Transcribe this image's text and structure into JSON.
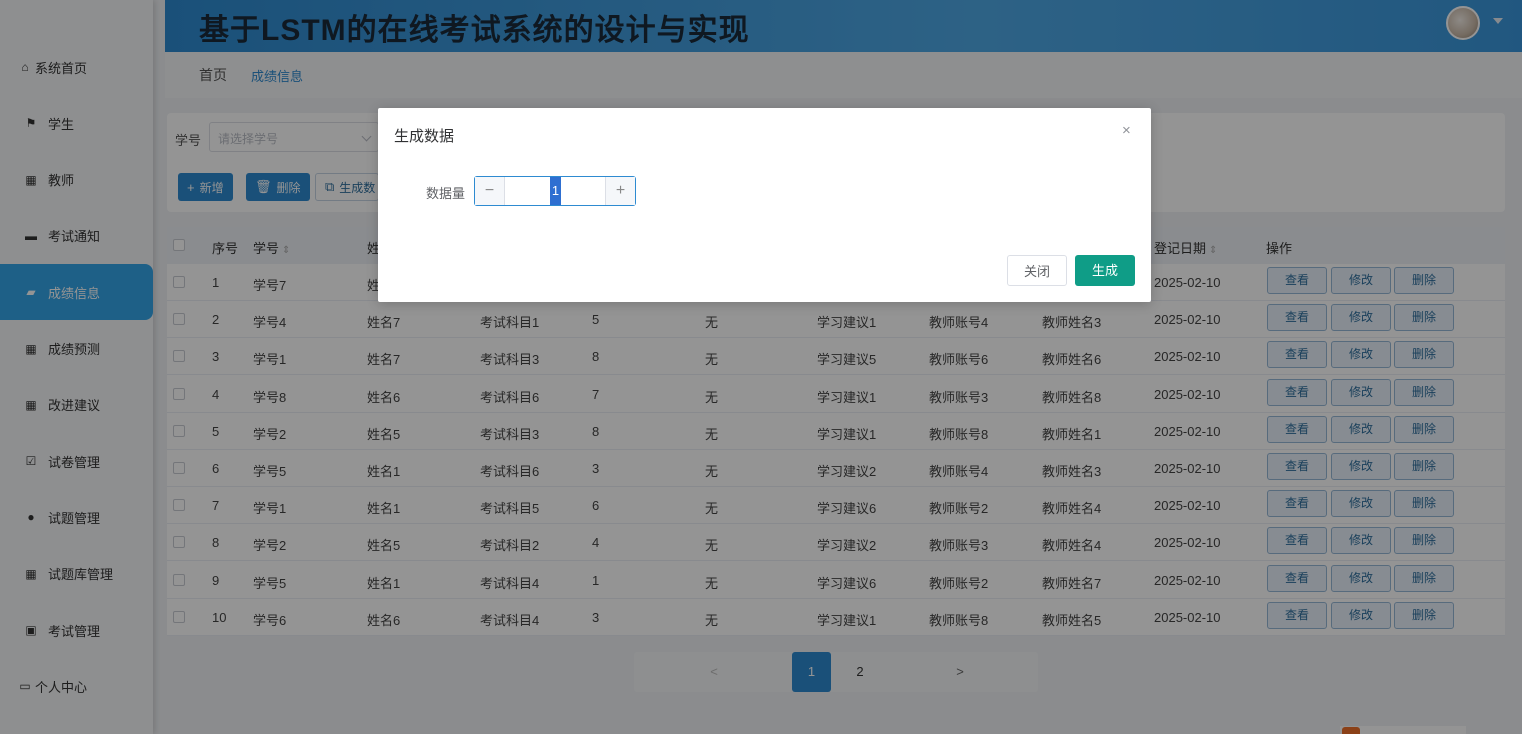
{
  "app": {
    "title": "基于LSTM的在线考试系统的设计与实现"
  },
  "sidebar": {
    "items": [
      {
        "label": "系统首页",
        "icon": "home-icon"
      },
      {
        "label": "学生",
        "icon": "flag-icon"
      },
      {
        "label": "教师",
        "icon": "grid-icon"
      },
      {
        "label": "考试通知",
        "icon": "bookmark-icon"
      },
      {
        "label": "成绩信息",
        "icon": "folder-icon",
        "active": true
      },
      {
        "label": "成绩预测",
        "icon": "grid-icon"
      },
      {
        "label": "改进建议",
        "icon": "grid-icon"
      },
      {
        "label": "试卷管理",
        "icon": "check-square-icon"
      },
      {
        "label": "试题管理",
        "icon": "user-icon"
      },
      {
        "label": "试题库管理",
        "icon": "grid-icon"
      },
      {
        "label": "考试管理",
        "icon": "ticket-icon"
      },
      {
        "label": "个人中心",
        "icon": "card-icon"
      }
    ]
  },
  "breadcrumb": {
    "home": "首页",
    "current": "成绩信息"
  },
  "search": {
    "label": "学号",
    "placeholder": "请选择学号"
  },
  "toolbar": {
    "add": "新增",
    "delete": "删除",
    "generate": "生成数"
  },
  "table": {
    "headers": {
      "seq": "序号",
      "student_id": "学号",
      "name": "姓",
      "date": "登记日期",
      "actions": "操作"
    },
    "actions": {
      "view": "查看",
      "edit": "修改",
      "delete": "删除"
    },
    "rows": [
      {
        "seq": "1",
        "sid": "学号7",
        "name": "姓",
        "subject": "",
        "score": "",
        "note": "",
        "advice": "",
        "t_acct": "",
        "t_name": "",
        "date": "2025-02-10"
      },
      {
        "seq": "2",
        "sid": "学号4",
        "name": "姓名7",
        "subject": "考试科目1",
        "score": "5",
        "note": "无",
        "advice": "学习建议1",
        "t_acct": "教师账号4",
        "t_name": "教师姓名3",
        "date": "2025-02-10"
      },
      {
        "seq": "3",
        "sid": "学号1",
        "name": "姓名7",
        "subject": "考试科目3",
        "score": "8",
        "note": "无",
        "advice": "学习建议5",
        "t_acct": "教师账号6",
        "t_name": "教师姓名6",
        "date": "2025-02-10"
      },
      {
        "seq": "4",
        "sid": "学号8",
        "name": "姓名6",
        "subject": "考试科目6",
        "score": "7",
        "note": "无",
        "advice": "学习建议1",
        "t_acct": "教师账号3",
        "t_name": "教师姓名8",
        "date": "2025-02-10"
      },
      {
        "seq": "5",
        "sid": "学号2",
        "name": "姓名5",
        "subject": "考试科目3",
        "score": "8",
        "note": "无",
        "advice": "学习建议1",
        "t_acct": "教师账号8",
        "t_name": "教师姓名1",
        "date": "2025-02-10"
      },
      {
        "seq": "6",
        "sid": "学号5",
        "name": "姓名1",
        "subject": "考试科目6",
        "score": "3",
        "note": "无",
        "advice": "学习建议2",
        "t_acct": "教师账号4",
        "t_name": "教师姓名3",
        "date": "2025-02-10"
      },
      {
        "seq": "7",
        "sid": "学号1",
        "name": "姓名1",
        "subject": "考试科目5",
        "score": "6",
        "note": "无",
        "advice": "学习建议6",
        "t_acct": "教师账号2",
        "t_name": "教师姓名4",
        "date": "2025-02-10"
      },
      {
        "seq": "8",
        "sid": "学号2",
        "name": "姓名5",
        "subject": "考试科目2",
        "score": "4",
        "note": "无",
        "advice": "学习建议2",
        "t_acct": "教师账号3",
        "t_name": "教师姓名4",
        "date": "2025-02-10"
      },
      {
        "seq": "9",
        "sid": "学号5",
        "name": "姓名1",
        "subject": "考试科目4",
        "score": "1",
        "note": "无",
        "advice": "学习建议6",
        "t_acct": "教师账号2",
        "t_name": "教师姓名7",
        "date": "2025-02-10"
      },
      {
        "seq": "10",
        "sid": "学号6",
        "name": "姓名6",
        "subject": "考试科目4",
        "score": "3",
        "note": "无",
        "advice": "学习建议1",
        "t_acct": "教师账号8",
        "t_name": "教师姓名5",
        "date": "2025-02-10"
      }
    ]
  },
  "pagination": {
    "prev": "<",
    "pages": [
      "1",
      "2"
    ],
    "current": "1",
    "next": ">"
  },
  "dialog": {
    "title": "生成数据",
    "close_icon": "×",
    "field_label": "数据量",
    "minus": "−",
    "plus": "+",
    "value": "1",
    "cancel": "关闭",
    "confirm": "生成"
  },
  "colors": {
    "primary": "#2e8bd1",
    "generate": "#0f9d87"
  }
}
